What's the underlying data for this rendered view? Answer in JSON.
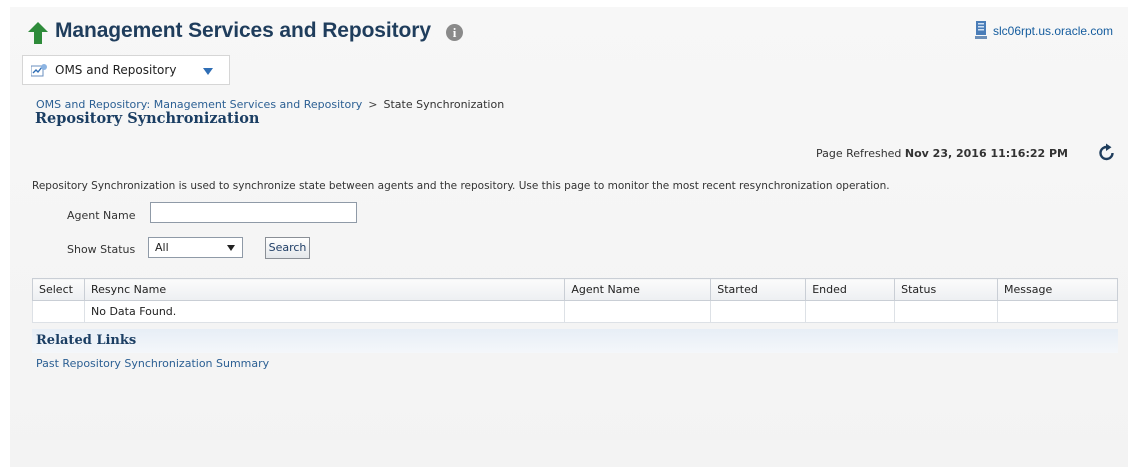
{
  "header": {
    "title": "Management Services and Repository",
    "host": "slc06rpt.us.oracle.com"
  },
  "target_menu": {
    "label": "OMS and Repository"
  },
  "breadcrumb": {
    "parent": "OMS and Repository: Management Services and Repository",
    "separator": ">",
    "current": "State Synchronization"
  },
  "page": {
    "section_title": "Repository Synchronization",
    "refreshed_label": "Page Refreshed",
    "refreshed_value": "Nov 23, 2016 11:16:22 PM",
    "description": "Repository Synchronization is used to synchronize state between agents and the repository. Use this page to monitor the most recent resynchronization operation."
  },
  "form": {
    "agent_name_label": "Agent Name",
    "agent_name_value": "",
    "show_status_label": "Show Status",
    "show_status_value": "All",
    "search_label": "Search"
  },
  "table": {
    "columns": [
      "Select",
      "Resync Name",
      "Agent Name",
      "Started",
      "Ended",
      "Status",
      "Message"
    ],
    "empty_message": "No Data Found."
  },
  "related": {
    "title": "Related Links",
    "links": [
      "Past Repository Synchronization Summary"
    ]
  },
  "colors": {
    "title": "#1f3d5c",
    "link": "#2b5f93",
    "up_arrow": "#2e8b3a",
    "menu_caret": "#2f6eb5"
  }
}
